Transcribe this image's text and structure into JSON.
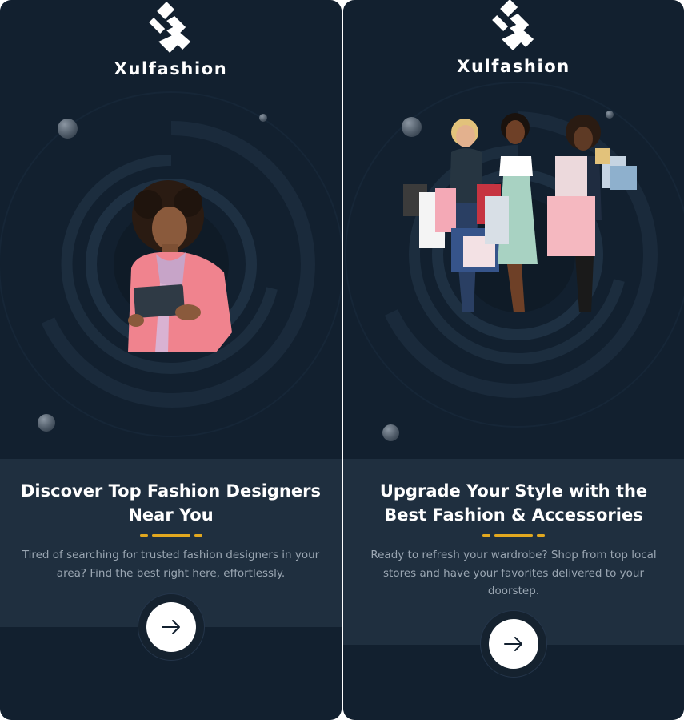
{
  "brand": {
    "name": "Xulfashion"
  },
  "screens": [
    {
      "title": "Discover Top Fashion Designers Near You",
      "description": "Tired of searching for trusted fashion designers in your area? Find the best right here, effortlessly.",
      "next_icon": "arrow-right-icon"
    },
    {
      "title": "Upgrade Your Style with the Best Fashion & Accessories",
      "description": "Ready to refresh your wardrobe? Shop from top local stores and have your favorites delivered to your doorstep.",
      "next_icon": "arrow-right-icon"
    }
  ],
  "colors": {
    "background": "#12202f",
    "panel": "#1f2f3f",
    "accent": "#e2a81f",
    "text_primary": "#ffffff",
    "text_secondary": "#9aa6b2"
  }
}
